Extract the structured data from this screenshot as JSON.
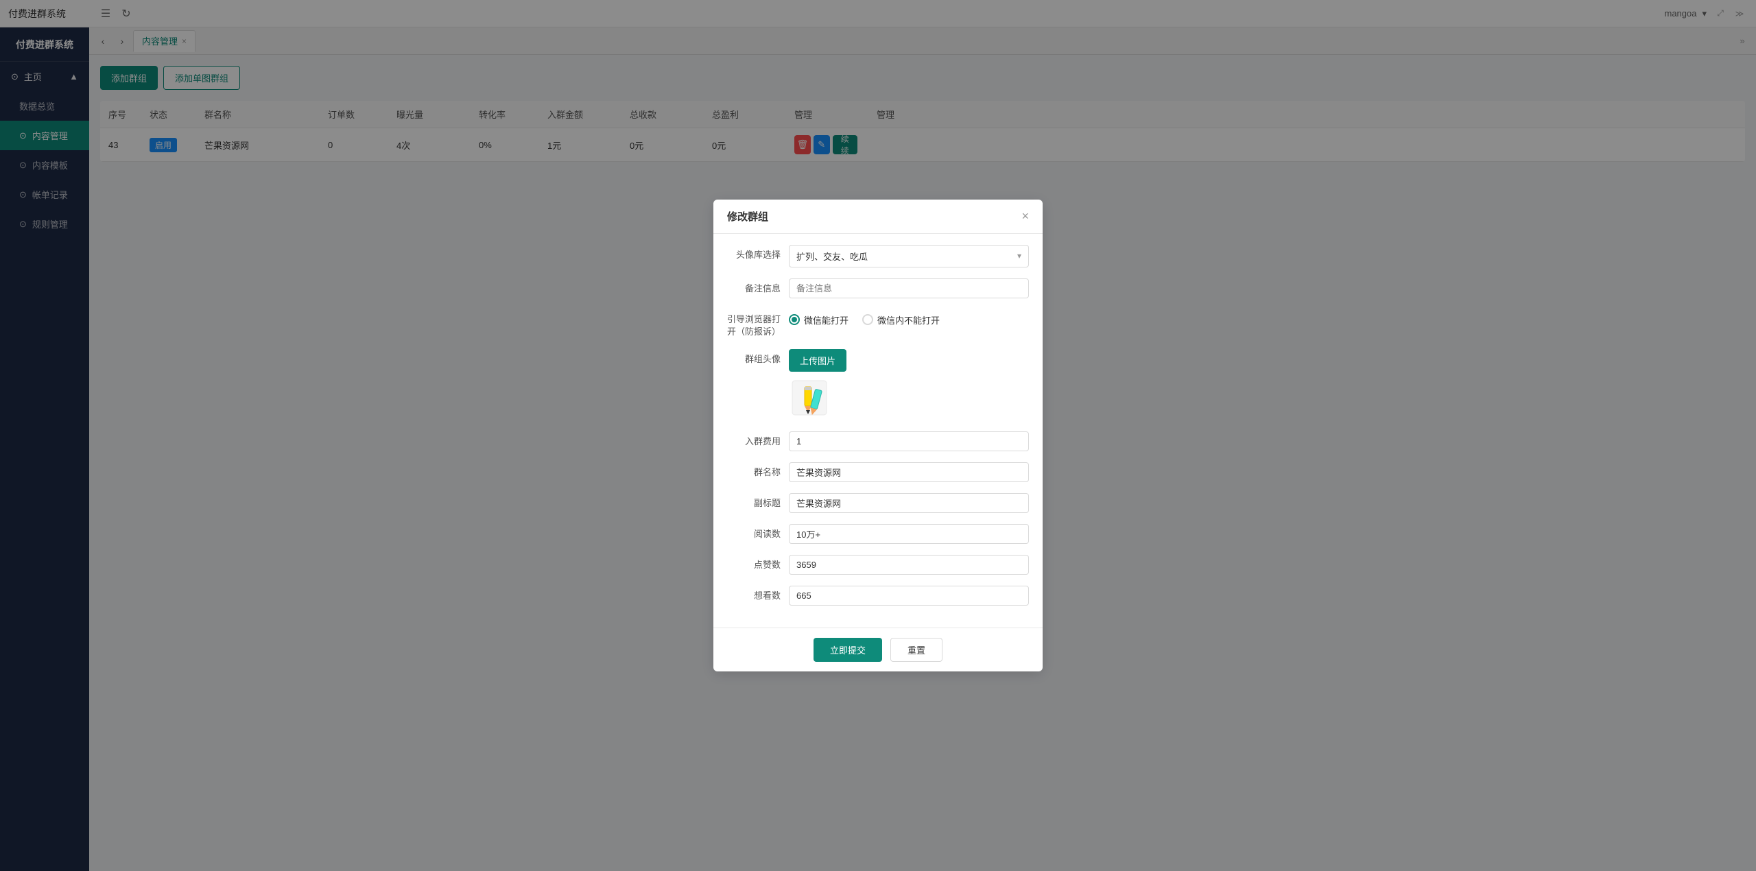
{
  "app": {
    "title": "付费进群系统",
    "user": "mangoa",
    "window_controls": [
      "expand",
      "more"
    ]
  },
  "tabs": [
    {
      "id": "content",
      "label": "内容管理",
      "active": true,
      "closable": true
    }
  ],
  "sidebar": {
    "logo": "付费进群系统",
    "sections": [
      {
        "items": [
          {
            "id": "home",
            "label": "主页",
            "icon": "⊙",
            "active": false,
            "has_arrow": true
          },
          {
            "id": "data-overview",
            "label": "数据总览",
            "icon": "",
            "active": false,
            "indent": true
          },
          {
            "id": "content-manage",
            "label": "内容管理",
            "icon": "⊙",
            "active": true,
            "indent": true
          },
          {
            "id": "content-template",
            "label": "内容模板",
            "icon": "⊙",
            "active": false,
            "indent": true
          },
          {
            "id": "orders",
            "label": "帐单记录",
            "icon": "⊙",
            "active": false,
            "indent": true
          },
          {
            "id": "rules",
            "label": "规则管理",
            "icon": "⊙",
            "active": false,
            "indent": true
          }
        ]
      }
    ]
  },
  "toolbar": {
    "add_group_label": "添加群组",
    "add_single_label": "添加单图群组"
  },
  "table": {
    "columns": [
      "序号",
      "状态",
      "群名称",
      "订单数",
      "曝光量",
      "转化率",
      "入群金额",
      "总收款",
      "总盈利",
      "管理",
      "管理"
    ],
    "rows": [
      {
        "id": 43,
        "status": "启用",
        "name": "芒果资源网",
        "orders": 0,
        "views": "4次",
        "conversion": "0%",
        "join_fee": "1元",
        "total_income": "0元",
        "total_profit": "0元",
        "actions": [
          "delete",
          "edit",
          "续续"
        ]
      }
    ]
  },
  "modal": {
    "title": "修改群组",
    "fields": {
      "avatar_library_label": "头像库选择",
      "avatar_library_value": "扩列、交友、吃瓜",
      "remark_label": "备注信息",
      "remark_placeholder": "备注信息",
      "remark_value": "",
      "browser_open_label": "引导浏览器打开（防报诉）",
      "browser_option1": "微信能打开",
      "browser_option2": "微信内不能打开",
      "browser_selected": "option1",
      "avatar_label": "群组头像",
      "upload_btn_label": "上传图片",
      "join_fee_label": "入群费用",
      "join_fee_value": "1",
      "group_name_label": "群名称",
      "group_name_value": "芒果资源网",
      "subtitle_label": "副标题",
      "subtitle_value": "芒果资源网",
      "read_count_label": "阅读数",
      "read_count_value": "10万+",
      "like_count_label": "点赞数",
      "like_count_value": "3659",
      "view_count_label": "想看数",
      "view_count_value": "665"
    },
    "footer": {
      "submit_label": "立即提交",
      "reset_label": "重置"
    }
  }
}
